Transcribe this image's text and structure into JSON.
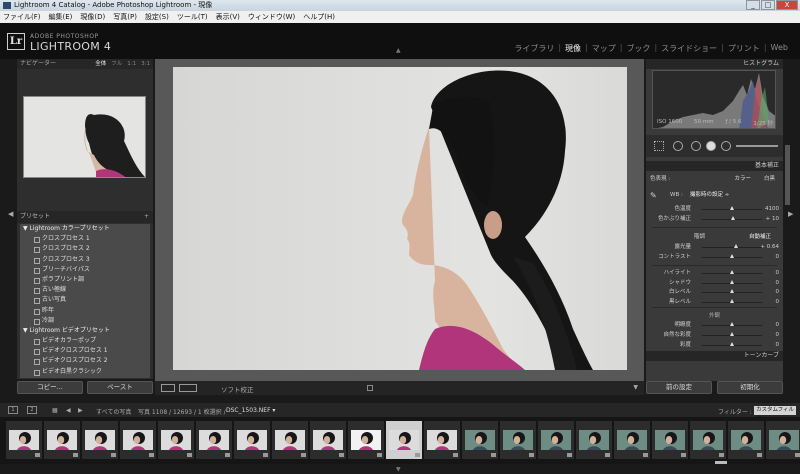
{
  "window": {
    "title": "Lightroom 4 Catalog - Adobe Photoshop Lightroom - 現像",
    "controls": {
      "minimize": "_",
      "maximize": "□",
      "close": "X"
    }
  },
  "menu": [
    "ファイル(F)",
    "編集(E)",
    "現像(D)",
    "写真(P)",
    "設定(S)",
    "ツール(T)",
    "表示(V)",
    "ウィンドウ(W)",
    "ヘルプ(H)"
  ],
  "header": {
    "logo": "Lr",
    "brand_small": "ADOBE PHOTOSHOP",
    "brand_big": "LIGHTROOM 4",
    "modules": [
      "ライブラリ",
      "現像",
      "マップ",
      "ブック",
      "スライドショー",
      "プリント",
      "Web"
    ],
    "separator": "|",
    "active_module": "現像"
  },
  "navigator": {
    "title": "ナビゲーター",
    "zoom_options": [
      "全体",
      "フル",
      "1:1",
      "3:1"
    ],
    "selected_zoom": "全体"
  },
  "presets": {
    "title": "プリセット",
    "add_symbol": "+",
    "rows": [
      {
        "type": "folder",
        "label": "▼ Lightroom カラープリセット"
      },
      {
        "type": "item",
        "label": "クロスプロセス 1"
      },
      {
        "type": "item",
        "label": "クロスプロセス 2"
      },
      {
        "type": "item",
        "label": "クロスプロセス 3"
      },
      {
        "type": "item",
        "label": "ブリーチバイパス"
      },
      {
        "type": "item",
        "label": "ポラプリント調"
      },
      {
        "type": "item",
        "label": "古い極線"
      },
      {
        "type": "item",
        "label": "古い写真"
      },
      {
        "type": "item",
        "label": "昨年"
      },
      {
        "type": "item",
        "label": "冷調"
      },
      {
        "type": "folder",
        "label": "▼ Lightroom ビデオプリセット"
      },
      {
        "type": "item",
        "label": "ビデオカラーポップ"
      },
      {
        "type": "item",
        "label": "ビデオクロスプロセス 1"
      },
      {
        "type": "item",
        "label": "ビデオクロスプロセス 2"
      },
      {
        "type": "item",
        "label": "ビデオ白黒クラシック"
      }
    ]
  },
  "left_buttons": {
    "copy": "コピー...",
    "paste": "ペースト"
  },
  "toolbar": {
    "soft_proof": "ソフト校正",
    "view_modes": [
      "□",
      "YY"
    ]
  },
  "histogram": {
    "title": "ヒストグラム",
    "iso": "ISO 1600",
    "focal": "50 mm",
    "aperture": "ƒ / 5.6",
    "shutter": "1/25 秒"
  },
  "basic": {
    "title": "基本補正",
    "treatment_label": "色表現 :",
    "treatment_color": "カラー",
    "treatment_bw": "白黒",
    "wb_label": "WB :",
    "wb_value": "撮影時の設定 ÷",
    "sliders_wb": [
      {
        "label": "色温度",
        "value": "4100",
        "pos": 0.5
      },
      {
        "label": "色かぶり補正",
        "value": "+ 10",
        "pos": 0.53
      }
    ],
    "tone_title": "階調",
    "auto": "自動補正",
    "sliders_tone": [
      {
        "label": "露光量",
        "value": "+ 0.64",
        "pos": 0.58
      },
      {
        "label": "コントラスト",
        "value": "0",
        "pos": 0.5
      }
    ],
    "sliders_presence_tone": [
      {
        "label": "ハイライト",
        "value": "0",
        "pos": 0.5
      },
      {
        "label": "シャドウ",
        "value": "0",
        "pos": 0.5
      },
      {
        "label": "白レベル",
        "value": "0",
        "pos": 0.5
      },
      {
        "label": "黒レベル",
        "value": "0",
        "pos": 0.5
      }
    ],
    "presence_title": "外観",
    "sliders_presence": [
      {
        "label": "明瞭度",
        "value": "0",
        "pos": 0.5
      },
      {
        "label": "自然な彩度",
        "value": "0",
        "pos": 0.5
      },
      {
        "label": "彩度",
        "value": "0",
        "pos": 0.5
      }
    ]
  },
  "tone_curve": {
    "title": "トーンカーブ"
  },
  "right_buttons": {
    "previous": "前の設定",
    "reset": "初期化"
  },
  "filmstrip_bar": {
    "pages": [
      "1",
      "2"
    ],
    "source": "すべての写真",
    "count": "写真 1108 / 12693 / 1 枚選択 /",
    "filename": "DSC_1503.NEF ▾",
    "filter_label": "フィルター :",
    "filter_value": "カスタムフィルター ÷"
  },
  "filmstrip": {
    "count": 22,
    "selected_index": 10
  },
  "colors": {
    "accent_magenta": "#b0357a",
    "panel_bg": "#3a3a3a",
    "selected_thumb": "#cfcfcf"
  }
}
